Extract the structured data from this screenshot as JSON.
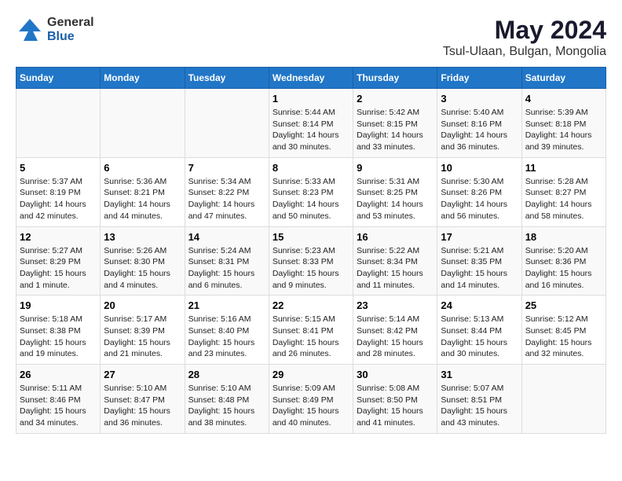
{
  "logo": {
    "general": "General",
    "blue": "Blue"
  },
  "title": "May 2024",
  "subtitle": "Tsul-Ulaan, Bulgan, Mongolia",
  "days_of_week": [
    "Sunday",
    "Monday",
    "Tuesday",
    "Wednesday",
    "Thursday",
    "Friday",
    "Saturday"
  ],
  "weeks": [
    [
      {
        "day": "",
        "info": ""
      },
      {
        "day": "",
        "info": ""
      },
      {
        "day": "",
        "info": ""
      },
      {
        "day": "1",
        "info": "Sunrise: 5:44 AM\nSunset: 8:14 PM\nDaylight: 14 hours and 30 minutes."
      },
      {
        "day": "2",
        "info": "Sunrise: 5:42 AM\nSunset: 8:15 PM\nDaylight: 14 hours and 33 minutes."
      },
      {
        "day": "3",
        "info": "Sunrise: 5:40 AM\nSunset: 8:16 PM\nDaylight: 14 hours and 36 minutes."
      },
      {
        "day": "4",
        "info": "Sunrise: 5:39 AM\nSunset: 8:18 PM\nDaylight: 14 hours and 39 minutes."
      }
    ],
    [
      {
        "day": "5",
        "info": "Sunrise: 5:37 AM\nSunset: 8:19 PM\nDaylight: 14 hours and 42 minutes."
      },
      {
        "day": "6",
        "info": "Sunrise: 5:36 AM\nSunset: 8:21 PM\nDaylight: 14 hours and 44 minutes."
      },
      {
        "day": "7",
        "info": "Sunrise: 5:34 AM\nSunset: 8:22 PM\nDaylight: 14 hours and 47 minutes."
      },
      {
        "day": "8",
        "info": "Sunrise: 5:33 AM\nSunset: 8:23 PM\nDaylight: 14 hours and 50 minutes."
      },
      {
        "day": "9",
        "info": "Sunrise: 5:31 AM\nSunset: 8:25 PM\nDaylight: 14 hours and 53 minutes."
      },
      {
        "day": "10",
        "info": "Sunrise: 5:30 AM\nSunset: 8:26 PM\nDaylight: 14 hours and 56 minutes."
      },
      {
        "day": "11",
        "info": "Sunrise: 5:28 AM\nSunset: 8:27 PM\nDaylight: 14 hours and 58 minutes."
      }
    ],
    [
      {
        "day": "12",
        "info": "Sunrise: 5:27 AM\nSunset: 8:29 PM\nDaylight: 15 hours and 1 minute."
      },
      {
        "day": "13",
        "info": "Sunrise: 5:26 AM\nSunset: 8:30 PM\nDaylight: 15 hours and 4 minutes."
      },
      {
        "day": "14",
        "info": "Sunrise: 5:24 AM\nSunset: 8:31 PM\nDaylight: 15 hours and 6 minutes."
      },
      {
        "day": "15",
        "info": "Sunrise: 5:23 AM\nSunset: 8:33 PM\nDaylight: 15 hours and 9 minutes."
      },
      {
        "day": "16",
        "info": "Sunrise: 5:22 AM\nSunset: 8:34 PM\nDaylight: 15 hours and 11 minutes."
      },
      {
        "day": "17",
        "info": "Sunrise: 5:21 AM\nSunset: 8:35 PM\nDaylight: 15 hours and 14 minutes."
      },
      {
        "day": "18",
        "info": "Sunrise: 5:20 AM\nSunset: 8:36 PM\nDaylight: 15 hours and 16 minutes."
      }
    ],
    [
      {
        "day": "19",
        "info": "Sunrise: 5:18 AM\nSunset: 8:38 PM\nDaylight: 15 hours and 19 minutes."
      },
      {
        "day": "20",
        "info": "Sunrise: 5:17 AM\nSunset: 8:39 PM\nDaylight: 15 hours and 21 minutes."
      },
      {
        "day": "21",
        "info": "Sunrise: 5:16 AM\nSunset: 8:40 PM\nDaylight: 15 hours and 23 minutes."
      },
      {
        "day": "22",
        "info": "Sunrise: 5:15 AM\nSunset: 8:41 PM\nDaylight: 15 hours and 26 minutes."
      },
      {
        "day": "23",
        "info": "Sunrise: 5:14 AM\nSunset: 8:42 PM\nDaylight: 15 hours and 28 minutes."
      },
      {
        "day": "24",
        "info": "Sunrise: 5:13 AM\nSunset: 8:44 PM\nDaylight: 15 hours and 30 minutes."
      },
      {
        "day": "25",
        "info": "Sunrise: 5:12 AM\nSunset: 8:45 PM\nDaylight: 15 hours and 32 minutes."
      }
    ],
    [
      {
        "day": "26",
        "info": "Sunrise: 5:11 AM\nSunset: 8:46 PM\nDaylight: 15 hours and 34 minutes."
      },
      {
        "day": "27",
        "info": "Sunrise: 5:10 AM\nSunset: 8:47 PM\nDaylight: 15 hours and 36 minutes."
      },
      {
        "day": "28",
        "info": "Sunrise: 5:10 AM\nSunset: 8:48 PM\nDaylight: 15 hours and 38 minutes."
      },
      {
        "day": "29",
        "info": "Sunrise: 5:09 AM\nSunset: 8:49 PM\nDaylight: 15 hours and 40 minutes."
      },
      {
        "day": "30",
        "info": "Sunrise: 5:08 AM\nSunset: 8:50 PM\nDaylight: 15 hours and 41 minutes."
      },
      {
        "day": "31",
        "info": "Sunrise: 5:07 AM\nSunset: 8:51 PM\nDaylight: 15 hours and 43 minutes."
      },
      {
        "day": "",
        "info": ""
      }
    ]
  ]
}
